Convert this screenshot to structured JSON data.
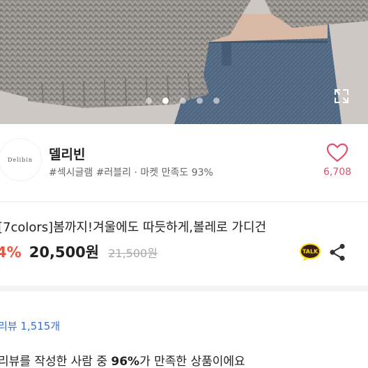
{
  "carousel": {
    "pages": 5,
    "active_index": 1
  },
  "seller": {
    "logo_text": "Delibin",
    "name": "델리빈",
    "tags": "#섹시글램 #러블리 · 마켓 만족도 93%",
    "like_count": "6,708"
  },
  "product": {
    "title": "[7colors]봄까지!겨울에도 따듯하게,볼레로 가디건",
    "discount": "4%",
    "price": "20,500원",
    "original_price": "21,500원"
  },
  "actions": {
    "talk_label": "TALK"
  },
  "review": {
    "link": "리뷰 1,515개",
    "summary_prefix": "리뷰를 작성한 사람 중 ",
    "summary_percent": "96%",
    "summary_suffix": "가 만족한 상품이에요"
  },
  "colors": {
    "accent_pink": "#e0506d",
    "discount_red": "#f0533d",
    "link_blue": "#3b6fc9",
    "talk_yellow": "#f9e000"
  },
  "icons": {
    "expand": "expand-icon",
    "heart": "heart-icon",
    "talk": "kakaotalk-icon",
    "share": "share-icon"
  }
}
